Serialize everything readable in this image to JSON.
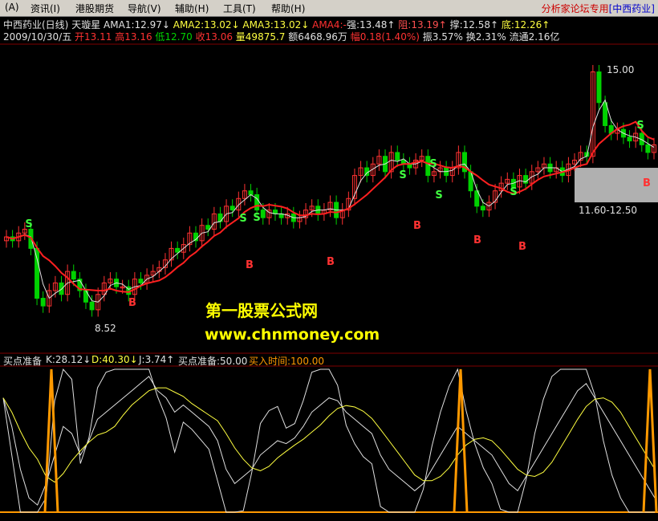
{
  "menu": {
    "items": [
      "(A)",
      "资讯(I)",
      "港股期货",
      "导航(V)",
      "辅助(H)",
      "工具(T)",
      "帮助(H)"
    ],
    "right_title": "分析家论坛专用",
    "right_stock": "[中西药业]"
  },
  "header": {
    "stock": "中西药业(日线)",
    "indicator": "天璇星",
    "ama1": "AMA1:12.97↓",
    "ama2": "AMA2:13.02↓",
    "ama3": "AMA3:13.02↓",
    "ama4": "AMA4:-",
    "qiang": "强:13.48↑",
    "zu": "阻:13.19↑",
    "cheng": "撑:12.58↑",
    "di": "底:12.26↑"
  },
  "quote": {
    "date": "2009/10/30/五",
    "open": "开13.11",
    "high": "高13.16",
    "low": "低12.70",
    "close": "收13.06",
    "volume": "量49875.7",
    "amount": "额6468.96万",
    "change": "幅0.18(1.40%)",
    "amplitude": "振3.57%",
    "turnover": "换2.31%",
    "float": "流通2.16亿"
  },
  "price_labels": {
    "high_mark": "15.00",
    "low_mark": "8.52",
    "box_range": "11.60-12.50"
  },
  "signals": {
    "sell": "S",
    "buy": "B"
  },
  "watermark": {
    "title": "第一股票公式网",
    "url": "www.chnmoney.com"
  },
  "indicator_panel": {
    "name": "买点准备",
    "k": "K:28.12↓",
    "d": "D:40.30↓",
    "j": "J:3.74↑",
    "prep": "买点准备:50.00",
    "buy_time": "买入时间:100.00"
  },
  "colors": {
    "up": "#ff3232",
    "down": "#00d200",
    "ama_red": "#ff2020",
    "ama_yellow": "#ffff40",
    "ama_green": "#40ff40",
    "orange": "#ff9900",
    "box": "#b0b0b0"
  }
}
